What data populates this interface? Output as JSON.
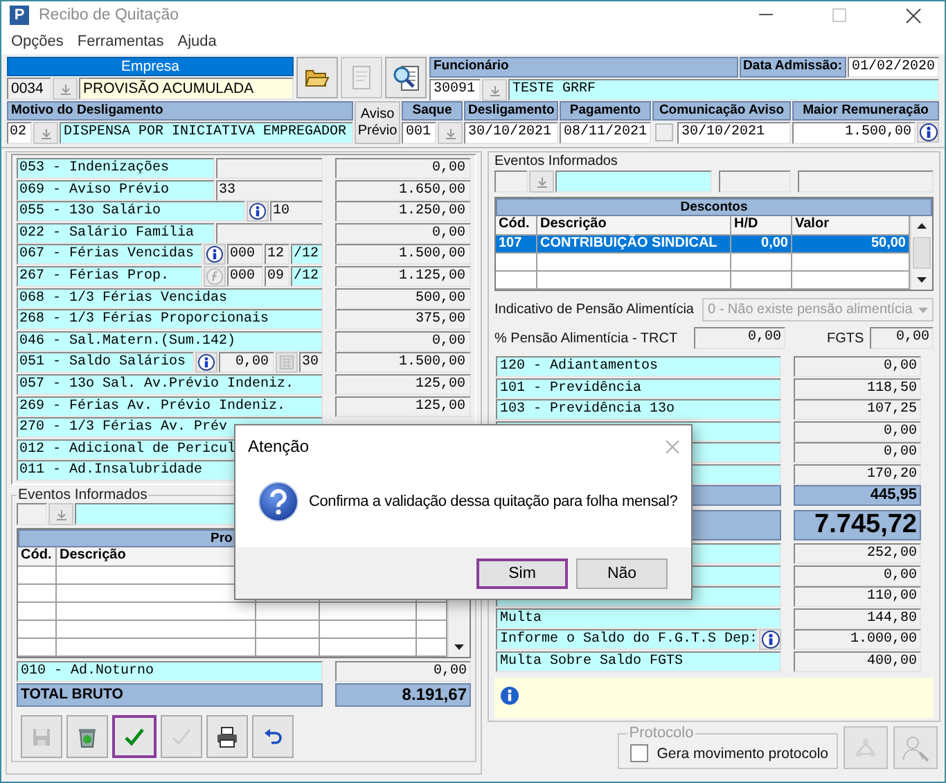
{
  "window": {
    "app_icon": "P",
    "title": "Recibo de Quitação"
  },
  "menu": [
    "Opções",
    "Ferramentas",
    "Ajuda"
  ],
  "header": {
    "empresa": {
      "label": "Empresa",
      "code": "0034",
      "name": "PROVISÃO ACUMULADA"
    },
    "funcionario": {
      "label": "Funcionário",
      "code": "30091",
      "name": "TESTE GRRF"
    },
    "data_admissao": {
      "label": "Data Admissão:",
      "value": "01/02/2020"
    },
    "motivo": {
      "label": "Motivo do Desligamento",
      "code": "02",
      "value": "DISPENSA POR INICIATIVA EMPREGADOR"
    },
    "aviso_previo_button": "Aviso Prévio",
    "saque": {
      "label": "Saque",
      "value": "001"
    },
    "desligamento": {
      "label": "Desligamento",
      "value": "30/10/2021"
    },
    "pagamento": {
      "label": "Pagamento",
      "value": "08/11/2021"
    },
    "comunicacao_aviso": {
      "label": "Comunicação Aviso",
      "checked": false,
      "value": "30/10/2021"
    },
    "maior_remuneracao": {
      "label": "Maior Remuneração",
      "value": "1.500,00"
    }
  },
  "proventos": [
    {
      "kind": "split",
      "label": "053 - Indenizações",
      "value": "0,00"
    },
    {
      "kind": "split",
      "label": "069 - Aviso Prévio",
      "cells": [
        "33"
      ],
      "value": "1.650,00"
    },
    {
      "kind": "split_info",
      "label": "055 - 13o Salário",
      "cells": [
        "10"
      ],
      "value": "1.250,00"
    },
    {
      "kind": "split",
      "label": "022 - Salário Família",
      "value": "0,00"
    },
    {
      "kind": "ferias_info",
      "label": "067 - Férias Vencidas",
      "cells": [
        "000",
        "12",
        "/12"
      ],
      "value": "1.500,00"
    },
    {
      "kind": "ferias_formula",
      "label": "267 - Férias Prop.",
      "cells": [
        "000",
        "09",
        "/12"
      ],
      "value": "1.125,00"
    },
    {
      "kind": "full",
      "label": "068 - 1/3 Férias Vencidas",
      "value": "500,00"
    },
    {
      "kind": "full",
      "label": "268 - 1/3 Férias Proporcionais",
      "value": "375,00"
    },
    {
      "kind": "full",
      "label": "046 - Sal.Matern.(Sum.142)",
      "value": "0,00"
    },
    {
      "kind": "saldo",
      "label": "051 - Saldo Salários",
      "cells": [
        "0,00",
        "30"
      ],
      "value": "1.500,00"
    },
    {
      "kind": "full",
      "label": "057 - 13o Sal. Av.Prévio Indeniz.",
      "value": "125,00"
    },
    {
      "kind": "full",
      "label": "269 - Férias Av. Prévio Indeniz.",
      "value": "125,00"
    },
    {
      "kind": "full",
      "label": "270 - 1/3 Férias Av. Prév"
    },
    {
      "kind": "full",
      "label": "012 - Adicional de Pericul"
    },
    {
      "kind": "full",
      "label": "011 - Ad.Insalubridade"
    }
  ],
  "eventos_informados_left": {
    "title": "Eventos Informados"
  },
  "proventos_table": {
    "title": "Pro",
    "columns": [
      "Cód.",
      "Descrição"
    ]
  },
  "extra_proventos": [
    {
      "label": "010 - Ad.Noturno",
      "value": "0,00"
    }
  ],
  "total_bruto": {
    "label": "TOTAL BRUTO",
    "value": "8.191,67"
  },
  "toolbar": [
    {
      "kind": "save",
      "disabled": true,
      "focused": false
    },
    {
      "kind": "delete",
      "disabled": false,
      "focused": false
    },
    {
      "kind": "confirm",
      "disabled": false,
      "focused": true
    },
    {
      "kind": "check",
      "disabled": true,
      "focused": false
    },
    {
      "kind": "print",
      "disabled": false,
      "focused": false
    },
    {
      "kind": "undo",
      "disabled": false,
      "focused": false
    }
  ],
  "eventos_informados_right": {
    "title": "Eventos Informados"
  },
  "descontos": {
    "title": "Descontos",
    "columns": [
      "Cód.",
      "Descrição",
      "H/D",
      "Valor"
    ],
    "rows": [
      {
        "cells": [
          "107",
          "CONTRIBUIÇÃO SINDICAL",
          "0,00",
          "50,00"
        ],
        "selected": true
      }
    ]
  },
  "pensao": {
    "label": "Indicativo de Pensão Alimentícia",
    "value": "0 - Não existe pensão alimentícia",
    "disabled": true
  },
  "pensao_trct": {
    "label": "% Pensão Alimentícia - TRCT",
    "value": "0,00"
  },
  "fgts": {
    "label": "FGTS",
    "value": "0,00"
  },
  "descontos_rows": [
    {
      "label": "120 - Adiantamentos",
      "value": "0,00"
    },
    {
      "label": "101 - Previdência",
      "value": "118,50"
    },
    {
      "label": "103 - Previdência 13o",
      "value": "107,25"
    },
    {
      "value": "0,00"
    },
    {
      "value": "0,00"
    },
    {
      "value": "170,20"
    }
  ],
  "total_descontos": {
    "value": "445,95"
  },
  "liquido": {
    "value": "7.745,72"
  },
  "fgts_rows": [
    {
      "kind": "plain",
      "value": "252,00"
    },
    {
      "kind": "plain",
      "value": "0,00"
    },
    {
      "kind": "plain",
      "value": "110,00"
    },
    {
      "kind": "plain",
      "label": "Multa",
      "value": "144,80"
    },
    {
      "kind": "info",
      "label": "Informe o Saldo do F.G.T.S Dep:",
      "value": "1.000,00"
    },
    {
      "kind": "plain",
      "label": "Multa Sobre Saldo FGTS",
      "value": "400,00"
    }
  ],
  "protocolo": {
    "title": "Protocolo",
    "checkbox_label": "Gera movimento protocolo",
    "checked": false
  },
  "protocol_buttons": [
    {
      "kind": "network",
      "disabled": true
    },
    {
      "kind": "person-search",
      "disabled": true
    }
  ],
  "dialog": {
    "title": "Atenção",
    "message": "Confirma a validação dessa quitação para folha mensal?",
    "buttons": [
      {
        "label": "Sim",
        "selected": true
      },
      {
        "label": "Não",
        "selected": false
      }
    ]
  }
}
